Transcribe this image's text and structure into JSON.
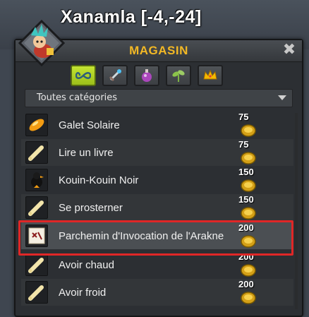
{
  "map_title": "Xanamla [-4,-24]",
  "shop": {
    "title": "MAGASIN",
    "close_label": "✖",
    "filter": {
      "selected": "Toutes catégories"
    },
    "tabs": [
      {
        "name": "all-tab",
        "icon": "infinity-icon",
        "active": true
      },
      {
        "name": "equipment-tab",
        "icon": "sword-icon",
        "active": false
      },
      {
        "name": "consumables-tab",
        "icon": "potion-icon",
        "active": false
      },
      {
        "name": "resources-tab",
        "icon": "plant-icon",
        "active": false
      },
      {
        "name": "cosmetics-tab",
        "icon": "crown-icon",
        "active": false
      }
    ],
    "items": [
      {
        "name": "Galet Solaire",
        "price": "75",
        "icon": "stone-icon"
      },
      {
        "name": "Lire un livre",
        "price": "75",
        "icon": "scroll-icon"
      },
      {
        "name": "Kouin-Kouin Noir",
        "price": "150",
        "icon": "black-bird-icon"
      },
      {
        "name": "Se prosterner",
        "price": "150",
        "icon": "scroll-icon"
      },
      {
        "name": "Parchemin d'Invocation de l'Arakne",
        "price": "200",
        "icon": "parchment-icon"
      },
      {
        "name": "Avoir chaud",
        "price": "200",
        "icon": "scroll-icon"
      },
      {
        "name": "Avoir froid",
        "price": "200",
        "icon": "scroll-icon"
      }
    ],
    "currency_icon": "gold-coin-icon"
  }
}
